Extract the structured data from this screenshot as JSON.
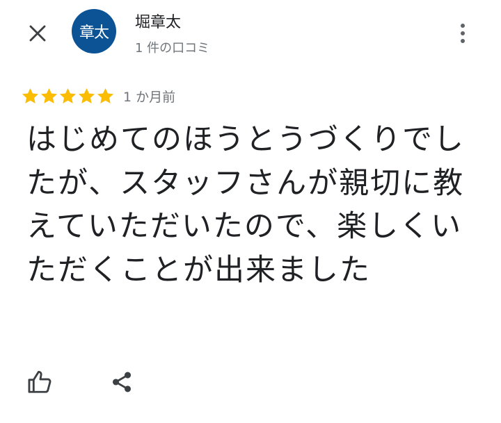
{
  "header": {
    "close_icon": "close-icon",
    "avatar_text": "章太",
    "avatar_color": "#0b5394",
    "reviewer_name": "堀章太",
    "review_count": "1 件の口コミ",
    "more_icon": "more-vert-icon"
  },
  "review": {
    "rating": 5,
    "max_rating": 5,
    "star_color": "#fbbc04",
    "time_ago": "1 か月前",
    "text": "はじめてのほうとうづくりでしたが、スタッフさんが親切に教えていただいたので、楽しくいただくことが出来ました"
  },
  "actions": {
    "like_icon": "thumb-up-icon",
    "share_icon": "share-icon"
  }
}
